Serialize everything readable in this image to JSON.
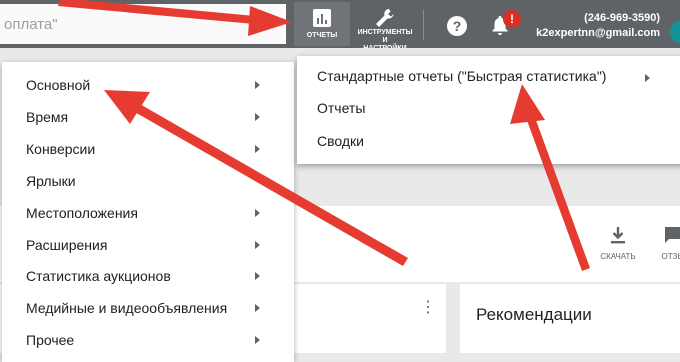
{
  "search": {
    "value": "оплата\""
  },
  "toolbar": {
    "reports_label": "ОТЧЕТЫ",
    "tools_label_line1": "ИНСТРУМЕНТЫ",
    "tools_label_line2": "И",
    "tools_label_line3": "НАСТРОЙКИ",
    "help_label": "?",
    "alert_badge": "!"
  },
  "account": {
    "phone": "(246-969-3590)",
    "email": "k2expertnn@gmail.com"
  },
  "report_menu": {
    "items": [
      {
        "label": "Основной",
        "has_submenu": true
      },
      {
        "label": "Время",
        "has_submenu": true
      },
      {
        "label": "Конверсии",
        "has_submenu": true
      },
      {
        "label": "Ярлыки",
        "has_submenu": false
      },
      {
        "label": "Местоположения",
        "has_submenu": true
      },
      {
        "label": "Расширения",
        "has_submenu": true
      },
      {
        "label": "Статистика аукционов",
        "has_submenu": true
      },
      {
        "label": "Медийные и видеообъявления",
        "has_submenu": true
      },
      {
        "label": "Прочее",
        "has_submenu": true
      }
    ]
  },
  "reports_submenu": {
    "items": [
      {
        "label": "Стандартные отчеты (\"Быстрая статистика\")",
        "has_submenu": true
      },
      {
        "label": "Отчеты",
        "has_submenu": false
      },
      {
        "label": "Сводки",
        "has_submenu": false
      }
    ]
  },
  "page": {
    "download_label": "СКАЧАТЬ",
    "feedback_label": "ОТЗЫ",
    "recommendations_title": "Рекомендации"
  },
  "colors": {
    "topbar": "#5f6368",
    "annotation_arrow": "#e53b30",
    "alert": "#d93025"
  }
}
